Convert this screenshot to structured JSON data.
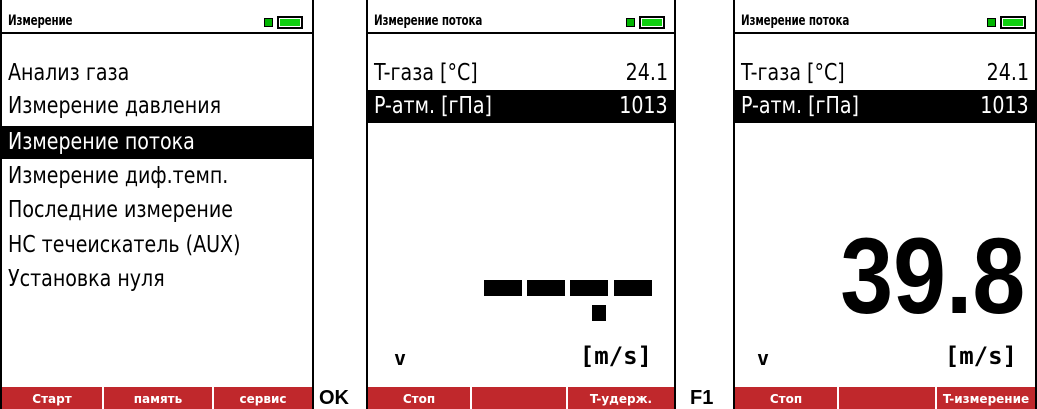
{
  "screens": [
    {
      "title": "Измерение",
      "menu": [
        {
          "label": "Анализ газа"
        },
        {
          "label": "Измерение давления"
        },
        {
          "label": "Измерение потока"
        },
        {
          "label": "Измерение диф.темп."
        },
        {
          "label": "Последние измерение"
        },
        {
          "label": "HC течеискатель (AUX)"
        },
        {
          "label": "Установка нуля"
        }
      ],
      "softkeys": [
        "Старт",
        "память",
        "сервис"
      ]
    },
    {
      "title": "Измерение потока",
      "rows": [
        {
          "label": "T-газа [°C]",
          "value": "24.1"
        },
        {
          "label": "P-атм. [гПа]",
          "value": "1013"
        }
      ],
      "measurement": {
        "symbol": "v",
        "unit": "[m/s]",
        "value": "---.-"
      },
      "softkeys": [
        "Стоп",
        "",
        "T-удерж."
      ]
    },
    {
      "title": "Измерение потока",
      "rows": [
        {
          "label": "T-газа [°C]",
          "value": "24.1"
        },
        {
          "label": "P-атм. [гПа]",
          "value": "1013"
        }
      ],
      "measurement": {
        "symbol": "v",
        "unit": "[m/s]",
        "value": "39.8"
      },
      "softkeys": [
        "Стоп",
        "",
        "T-измерение"
      ]
    }
  ],
  "key_labels": {
    "ok": "OK",
    "f1": "F1"
  },
  "colors": {
    "softkey_bar": "#c0282c",
    "battery": "#10d010",
    "selection": "#000000"
  }
}
